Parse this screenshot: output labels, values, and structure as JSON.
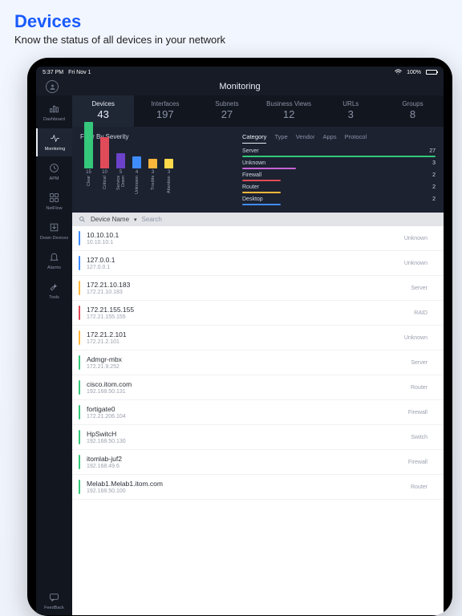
{
  "page": {
    "title": "Devices",
    "subtitle": "Know the status of all devices in your network"
  },
  "status": {
    "time": "5:37 PM",
    "date": "Fri Nov 1",
    "battery_pct": 100,
    "battery_label": "100%",
    "wifi": true
  },
  "header": {
    "title": "Monitoring"
  },
  "sidebar": {
    "items": [
      {
        "label": "Dashboard",
        "icon": "dashboard-icon"
      },
      {
        "label": "Monitoring",
        "icon": "pulse-icon",
        "active": true
      },
      {
        "label": "APM",
        "icon": "clock-icon"
      },
      {
        "label": "NetFlow",
        "icon": "netflow-icon"
      },
      {
        "label": "Down Devices",
        "icon": "download-icon"
      },
      {
        "label": "Alarms",
        "icon": "bell-icon"
      },
      {
        "label": "Tools",
        "icon": "wrench-icon"
      }
    ],
    "footer": {
      "label": "FeedBack",
      "icon": "chat-icon"
    }
  },
  "tabs": [
    {
      "label": "Devices",
      "count": 43,
      "active": true
    },
    {
      "label": "Interfaces",
      "count": 197
    },
    {
      "label": "Subnets",
      "count": 27
    },
    {
      "label": "Business Views",
      "count": 12
    },
    {
      "label": "URLs",
      "count": 3
    },
    {
      "label": "Groups",
      "count": 8
    }
  ],
  "chart_data": {
    "type": "bar",
    "title": "Filter By Severity",
    "categories": [
      "Clear",
      "Critical",
      "Service Down",
      "Unknown",
      "Trouble",
      "Attention"
    ],
    "values": [
      15,
      10,
      5,
      4,
      3,
      3
    ],
    "colors": [
      "#35c77b",
      "#e04b59",
      "#6b42c9",
      "#3f8cff",
      "#ffb63d",
      "#ffd94b"
    ],
    "ylim": [
      0,
      15
    ]
  },
  "category_panel": {
    "tabs": [
      "Category",
      "Type",
      "Vendor",
      "Apps",
      "Protocol"
    ],
    "active_tab": "Category",
    "rows": [
      {
        "name": "Server",
        "count": 27,
        "color": "#35c77b",
        "pct": 100
      },
      {
        "name": "Unknown",
        "count": 3,
        "color": "#c763d6",
        "pct": 28
      },
      {
        "name": "Firewall",
        "count": 2,
        "color": "#e04b59",
        "pct": 20
      },
      {
        "name": "Router",
        "count": 2,
        "color": "#ffb63d",
        "pct": 20
      },
      {
        "name": "Desktop",
        "count": 2,
        "color": "#3f8cff",
        "pct": 20
      }
    ]
  },
  "search": {
    "field_label": "Device Name",
    "placeholder": "Search"
  },
  "severity_colors": {
    "unknown": "#3f8cff",
    "server_ok": "#35c77b",
    "critical": "#e04b59",
    "trouble": "#ffb63d",
    "service_down": "#6b42c9",
    "attention": "#ffd94b"
  },
  "devices": [
    {
      "name": "10.10.10.1",
      "ip": "10.10.10.1",
      "type": "Unknown",
      "stripe": "#3f8cff"
    },
    {
      "name": "127.0.0.1",
      "ip": "127.0.0.1",
      "type": "Unknown",
      "stripe": "#3f8cff"
    },
    {
      "name": "172.21.10.183",
      "ip": "172.21.10.183",
      "type": "Server",
      "stripe": "#ffb63d"
    },
    {
      "name": "172.21.155.155",
      "ip": "172.21.155.155",
      "type": "RAID",
      "stripe": "#e04b59"
    },
    {
      "name": "172.21.2.101",
      "ip": "172.21.2.101",
      "type": "Unknown",
      "stripe": "#ffb63d"
    },
    {
      "name": "Admgr-mbx",
      "ip": "172.21.9.252",
      "type": "Server",
      "stripe": "#35c77b"
    },
    {
      "name": "cisco.itom.com",
      "ip": "192.168.50.131",
      "type": "Router",
      "stripe": "#35c77b"
    },
    {
      "name": "fortigate0",
      "ip": "172.21.206.104",
      "type": "Firewall",
      "stripe": "#35c77b"
    },
    {
      "name": "HpSwitcH",
      "ip": "192.168.50.130",
      "type": "Switch",
      "stripe": "#35c77b"
    },
    {
      "name": "itomlab-juf2",
      "ip": "192.168.49.6",
      "type": "Firewall",
      "stripe": "#35c77b"
    },
    {
      "name": "Melab1.Melab1.itom.com",
      "ip": "192.168.50.100",
      "type": "Router",
      "stripe": "#35c77b"
    }
  ]
}
